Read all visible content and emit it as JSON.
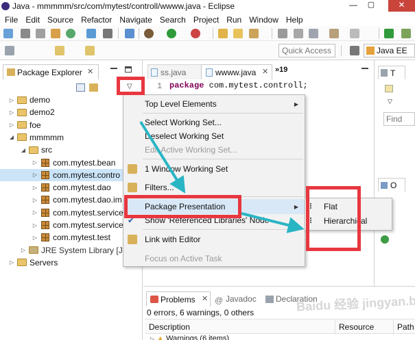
{
  "window": {
    "title": "Java - mmmmm/src/com/mytest/controll/wwww.java - Eclipse"
  },
  "menubar": [
    "File",
    "Edit",
    "Source",
    "Refactor",
    "Navigate",
    "Search",
    "Project",
    "Run",
    "Window",
    "Help"
  ],
  "toolbar": {
    "quick_access": "Quick Access",
    "perspective": "Java EE"
  },
  "package_explorer": {
    "title": "Package Explorer",
    "tree": [
      {
        "label": "demo",
        "kind": "project",
        "depth": 0,
        "twisty": "▷"
      },
      {
        "label": "demo2",
        "kind": "project",
        "depth": 0,
        "twisty": "▷"
      },
      {
        "label": "foe",
        "kind": "project",
        "depth": 0,
        "twisty": "▷"
      },
      {
        "label": "mmmmm",
        "kind": "project",
        "depth": 0,
        "twisty": "◢"
      },
      {
        "label": "src",
        "kind": "folder",
        "depth": 1,
        "twisty": "◢"
      },
      {
        "label": "com.mytest.bean",
        "kind": "package",
        "depth": 2,
        "twisty": "▷"
      },
      {
        "label": "com.mytest.contro",
        "kind": "package",
        "depth": 2,
        "twisty": "▷"
      },
      {
        "label": "com.mytest.dao",
        "kind": "package",
        "depth": 2,
        "twisty": "▷"
      },
      {
        "label": "com.mytest.dao.im",
        "kind": "package",
        "depth": 2,
        "twisty": "▷"
      },
      {
        "label": "com.mytest.service",
        "kind": "package",
        "depth": 2,
        "twisty": "▷"
      },
      {
        "label": "com.mytest.service",
        "kind": "package",
        "depth": 2,
        "twisty": "▷"
      },
      {
        "label": "com.mytest.test",
        "kind": "package",
        "depth": 2,
        "twisty": "▷"
      },
      {
        "label": "JRE System Library [Ja",
        "kind": "library",
        "depth": 1,
        "twisty": "▷"
      },
      {
        "label": "Servers",
        "kind": "project",
        "depth": 0,
        "twisty": "▷"
      }
    ]
  },
  "editor": {
    "tabs": [
      {
        "label": "ss.java"
      },
      {
        "label": "wwww.java"
      }
    ],
    "overflow": "»19",
    "line_number": "1",
    "keyword": "package",
    "code_rest": " com.mytest.controll;"
  },
  "context_menu": {
    "items": [
      {
        "label": "Top Level Elements",
        "submenu": true
      },
      {
        "label": "Select Working Set..."
      },
      {
        "label": "Deselect Working Set"
      },
      {
        "label": "Edit Active Working Set...",
        "disabled": true
      },
      {
        "label": "1 Window Working Set",
        "icon": true
      },
      {
        "label": "Filters...",
        "icon": true
      },
      {
        "label": "Package Presentation",
        "submenu": true
      },
      {
        "label": "Show 'Referenced Libraries' Node",
        "check": true
      },
      {
        "label": "Link with Editor",
        "icon": true
      },
      {
        "label": "Focus on Active Task",
        "disabled": true
      }
    ],
    "submenu": [
      "Flat",
      "Hierarchical"
    ]
  },
  "right_panel": {
    "task_tab": "T",
    "find": "Find",
    "outline_tab": "O"
  },
  "bottom": {
    "tabs": [
      "Problems",
      "Javadoc",
      "Declaration"
    ],
    "summary": "0 errors, 6 warnings, 0 others",
    "columns": [
      "Description",
      "Resource",
      "Path"
    ],
    "row": "Warnings (6 items)"
  },
  "watermark": "Baidu 经验 jingyan.baidu.com",
  "colors": {
    "highlight": "#e8373f",
    "arrow": "#2ab5c4",
    "selection": "#cce4f7"
  }
}
